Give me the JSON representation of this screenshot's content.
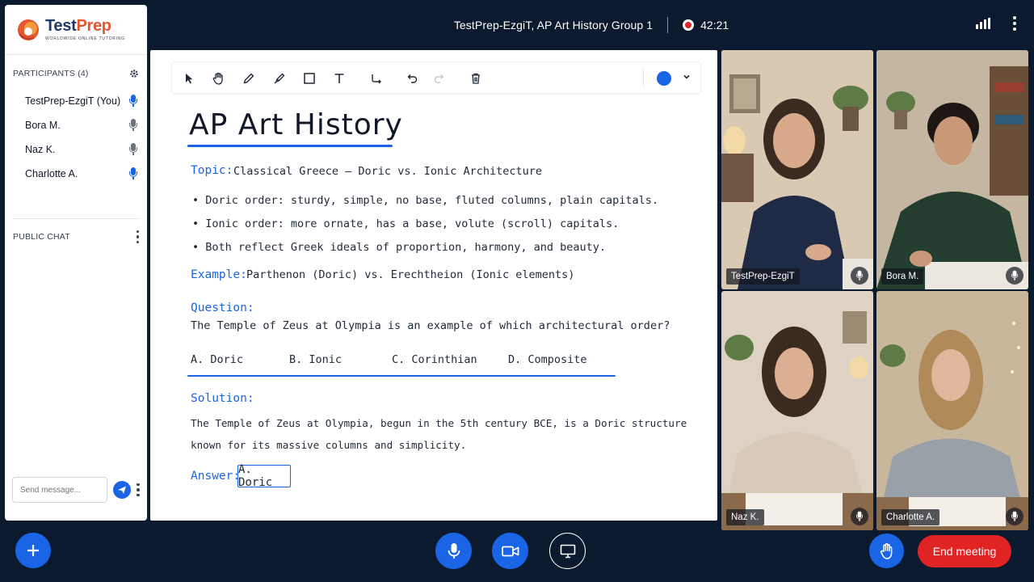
{
  "meeting": {
    "title": "TestPrep-EzgiT, AP Art History Group 1",
    "timer": "42:21",
    "recording_icon": "record-icon",
    "colors": {
      "background": "#0c1a30",
      "accent": "#1a64e6",
      "danger": "#e02424"
    }
  },
  "logo": {
    "brand_prefix": "Test",
    "brand_suffix": "Prep",
    "tagline": "WORLDWIDE ONLINE TUTORING"
  },
  "participants": {
    "header": "PARTICIPANTS (4)",
    "items": [
      {
        "name": "TestPrep-EzgiT (You)",
        "mic_active": true
      },
      {
        "name": "Bora M.",
        "mic_active": false
      },
      {
        "name": "Naz K.",
        "mic_active": false
      },
      {
        "name": "Charlotte A.",
        "mic_active": true
      }
    ]
  },
  "chat": {
    "header": "PUBLIC CHAT",
    "placeholder": "Send message..."
  },
  "whiteboard": {
    "title": "AP Art History",
    "topic_label": "Topic:",
    "topic_text": "Classical Greece — Doric vs. Ionic Architecture",
    "bullets": [
      "• Doric order: sturdy, simple, no base, fluted columns, plain capitals.",
      "• Ionic order: more ornate, has a base, volute (scroll) capitals.",
      "• Both reflect Greek ideals of proportion, harmony, and beauty."
    ],
    "example_label": "Example:",
    "example_text": "Parthenon (Doric) vs. Erechtheion (Ionic elements)",
    "question_label": "Question:",
    "question_text": "The Temple of Zeus at Olympia is an example of which architectural order?",
    "options": [
      "A. Doric",
      "B. Ionic",
      "C. Corinthian",
      "D. Composite"
    ],
    "solution_label": "Solution:",
    "solution_line1": "The Temple of Zeus at Olympia, begun in the 5th century BCE, is a Doric structure",
    "solution_line2": "known for its massive columns and simplicity.",
    "answer_label": "Answer:",
    "answer_text": "A. Doric",
    "pen_color": "#1a64e6"
  },
  "toolbar_icons": [
    "select-icon",
    "hand-icon",
    "pencil-icon",
    "highlighter-icon",
    "rectangle-icon",
    "text-icon",
    "connector-icon",
    "undo-icon",
    "redo-icon",
    "trash-icon"
  ],
  "videos": [
    {
      "name": "TestPrep-EzgiT"
    },
    {
      "name": "Bora M."
    },
    {
      "name": "Naz K."
    },
    {
      "name": "Charlotte A."
    }
  ],
  "controls": {
    "end_meeting": "End meeting"
  }
}
